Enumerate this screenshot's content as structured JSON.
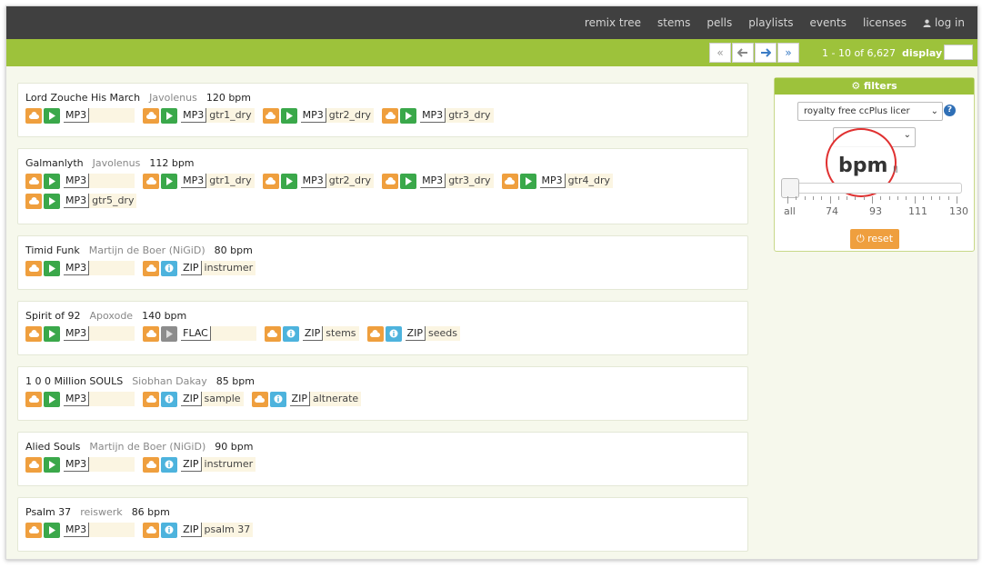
{
  "nav": {
    "links": [
      "remix tree",
      "stems",
      "pells",
      "playlists",
      "events",
      "licenses"
    ],
    "login": "log in"
  },
  "pager": {
    "first": "«",
    "prev": "🡠",
    "next": "🡢",
    "last": "»",
    "range": "1 - 10 of 6,627",
    "display_label": "display"
  },
  "tracks": [
    {
      "title": "Lord Zouche His March",
      "artist": "Javolenus",
      "bpm": "120 bpm",
      "rows": [
        [
          {
            "type": "play",
            "fmt": "MP3",
            "name": ""
          },
          {
            "type": "play",
            "fmt": "MP3",
            "name": "gtr1_dry"
          },
          {
            "type": "play",
            "fmt": "MP3",
            "name": "gtr2_dry"
          },
          {
            "type": "play",
            "fmt": "MP3",
            "name": "gtr3_dry"
          }
        ]
      ]
    },
    {
      "title": "Galmanlyth",
      "artist": "Javolenus",
      "bpm": "112 bpm",
      "rows": [
        [
          {
            "type": "play",
            "fmt": "MP3",
            "name": ""
          },
          {
            "type": "play",
            "fmt": "MP3",
            "name": "gtr1_dry"
          },
          {
            "type": "play",
            "fmt": "MP3",
            "name": "gtr2_dry"
          },
          {
            "type": "play",
            "fmt": "MP3",
            "name": "gtr3_dry"
          },
          {
            "type": "play",
            "fmt": "MP3",
            "name": "gtr4_dry"
          }
        ],
        [
          {
            "type": "play",
            "fmt": "MP3",
            "name": "gtr5_dry"
          }
        ]
      ]
    },
    {
      "title": "Timid Funk",
      "artist": "Martijn de Boer (NiGiD)",
      "bpm": "80 bpm",
      "rows": [
        [
          {
            "type": "play",
            "fmt": "MP3",
            "name": ""
          },
          {
            "type": "info",
            "fmt": "ZIP",
            "name": "instrumer"
          }
        ]
      ]
    },
    {
      "title": "Spirit of 92",
      "artist": "Apoxode",
      "bpm": "140 bpm",
      "rows": [
        [
          {
            "type": "play",
            "fmt": "MP3",
            "name": ""
          },
          {
            "type": "playgray",
            "fmt": "FLAC",
            "name": ""
          },
          {
            "type": "info",
            "fmt": "ZIP",
            "name": "stems"
          },
          {
            "type": "info",
            "fmt": "ZIP",
            "name": "seeds"
          }
        ]
      ]
    },
    {
      "title": "1 0 0 Million SOULS",
      "artist": "Siobhan Dakay",
      "bpm": "85 bpm",
      "rows": [
        [
          {
            "type": "play",
            "fmt": "MP3",
            "name": ""
          },
          {
            "type": "info",
            "fmt": "ZIP",
            "name": "sample"
          },
          {
            "type": "info",
            "fmt": "ZIP",
            "name": "altnerate"
          }
        ]
      ]
    },
    {
      "title": "Alied Souls",
      "artist": "Martijn de Boer (NiGiD)",
      "bpm": "90 bpm",
      "rows": [
        [
          {
            "type": "play",
            "fmt": "MP3",
            "name": ""
          },
          {
            "type": "info",
            "fmt": "ZIP",
            "name": "instrumer"
          }
        ]
      ]
    },
    {
      "title": "Psalm 37",
      "artist": "reiswerk",
      "bpm": "86 bpm",
      "rows": [
        [
          {
            "type": "play",
            "fmt": "MP3",
            "name": ""
          },
          {
            "type": "info",
            "fmt": "ZIP",
            "name": "psalm 37"
          }
        ]
      ]
    }
  ],
  "filters": {
    "title": "filters",
    "license_select": "royalty free ccPlus licer",
    "help": "?",
    "bpm_label": "bpm",
    "ll_text": "ll",
    "slider_labels": [
      "all",
      "74",
      "93",
      "111",
      "130"
    ],
    "reset_label": "reset"
  },
  "colors": {
    "nav_bg": "#404040",
    "green": "#9dc23b",
    "orange": "#ef9f3e",
    "play_green": "#3aa84a",
    "info_blue": "#4db3dd",
    "highlight_red": "#e03030"
  }
}
